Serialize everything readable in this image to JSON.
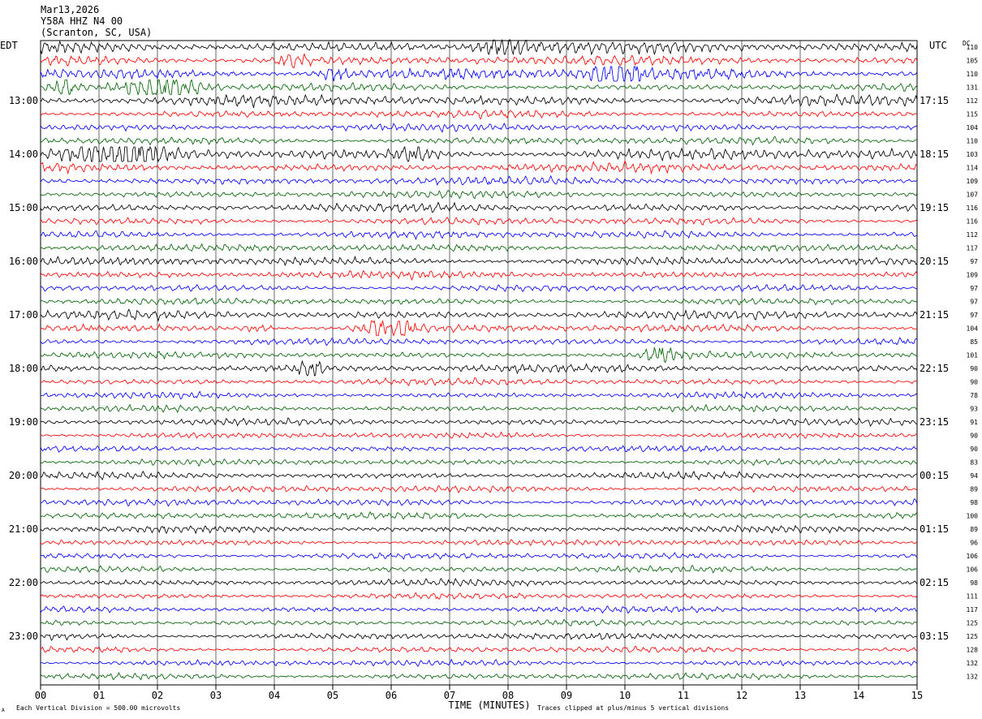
{
  "header": {
    "date": "Mar13,2026",
    "station": "Y58A HHZ N4 00",
    "location": "(Scranton, SC, USA)"
  },
  "labels": {
    "left_tz": "EDT",
    "right_tz": "UTC",
    "dc_header": "DC",
    "x_axis_title": "TIME (MINUTES)",
    "footer_left": "Each Vertical Division =  500.00 microvolts",
    "footer_right": "Traces clipped at plus/minus 5 vertical divisions",
    "footer_mark": "A"
  },
  "chart_data": {
    "type": "line",
    "title": "Y58A HHZ N4 00",
    "xlabel": "TIME (MINUTES)",
    "xlim": [
      0,
      15
    ],
    "x_ticks": [
      "00",
      "01",
      "02",
      "03",
      "04",
      "05",
      "06",
      "07",
      "08",
      "09",
      "10",
      "11",
      "12",
      "13",
      "14",
      "15"
    ],
    "trace_minutes": 15,
    "trace_count": 48,
    "trace_colors": [
      "#000000",
      "#ff0000",
      "#0000ff",
      "#006400"
    ],
    "left_hour_labels": [
      "13:00",
      "14:00",
      "15:00",
      "16:00",
      "17:00",
      "18:00",
      "19:00",
      "20:00",
      "21:00",
      "22:00",
      "23:00"
    ],
    "right_hour_labels": [
      "17:15",
      "18:15",
      "19:15",
      "20:15",
      "21:15",
      "22:15",
      "23:15",
      "00:15",
      "01:15",
      "02:15",
      "03:15"
    ],
    "hour_label_trace_index": [
      4,
      8,
      12,
      16,
      20,
      24,
      28,
      32,
      36,
      40,
      44
    ],
    "dc_offsets": [
      110,
      105,
      110,
      131,
      112,
      115,
      104,
      110,
      103,
      114,
      109,
      107,
      116,
      116,
      112,
      117,
      97,
      109,
      97,
      97,
      97,
      104,
      85,
      101,
      90,
      90,
      78,
      93,
      91,
      90,
      90,
      83,
      94,
      89,
      98,
      100,
      89,
      96,
      106,
      106,
      98,
      111,
      117,
      125,
      125,
      128,
      132,
      132
    ],
    "trace_amplitude": [
      1.6,
      1.3,
      1.6,
      1.0,
      1.5,
      1.0,
      1.0,
      1.0,
      1.5,
      1.2,
      1.1,
      1.0,
      1.2,
      1.0,
      1.0,
      1.0,
      1.1,
      1.0,
      0.9,
      0.9,
      1.2,
      1.0,
      0.9,
      0.9,
      1.1,
      0.9,
      0.8,
      0.8,
      0.9,
      0.8,
      0.8,
      0.8,
      0.9,
      0.9,
      0.9,
      0.9,
      0.9,
      0.8,
      0.8,
      0.8,
      0.9,
      0.8,
      0.8,
      0.8,
      0.9,
      0.8,
      0.8,
      0.8
    ],
    "bursts": [
      {
        "trace": 0,
        "minute": 7.9,
        "width": 0.5,
        "gain": 2.0
      },
      {
        "trace": 1,
        "minute": 4.3,
        "width": 0.4,
        "gain": 1.6
      },
      {
        "trace": 2,
        "minute": 9.8,
        "width": 0.5,
        "gain": 2.0
      },
      {
        "trace": 2,
        "minute": 5.0,
        "width": 0.3,
        "gain": 1.4
      },
      {
        "trace": 3,
        "minute": 2.1,
        "width": 0.8,
        "gain": 2.6
      },
      {
        "trace": 3,
        "minute": 0.4,
        "width": 0.3,
        "gain": 1.5
      },
      {
        "trace": 8,
        "minute": 1.4,
        "width": 0.9,
        "gain": 2.2
      },
      {
        "trace": 8,
        "minute": 6.4,
        "width": 0.4,
        "gain": 1.5
      },
      {
        "trace": 21,
        "minute": 5.9,
        "width": 0.6,
        "gain": 2.4
      },
      {
        "trace": 21,
        "minute": 3.7,
        "width": 0.3,
        "gain": 1.5
      },
      {
        "trace": 24,
        "minute": 4.6,
        "width": 0.3,
        "gain": 1.7
      },
      {
        "trace": 23,
        "minute": 10.6,
        "width": 0.4,
        "gain": 1.4
      }
    ]
  }
}
